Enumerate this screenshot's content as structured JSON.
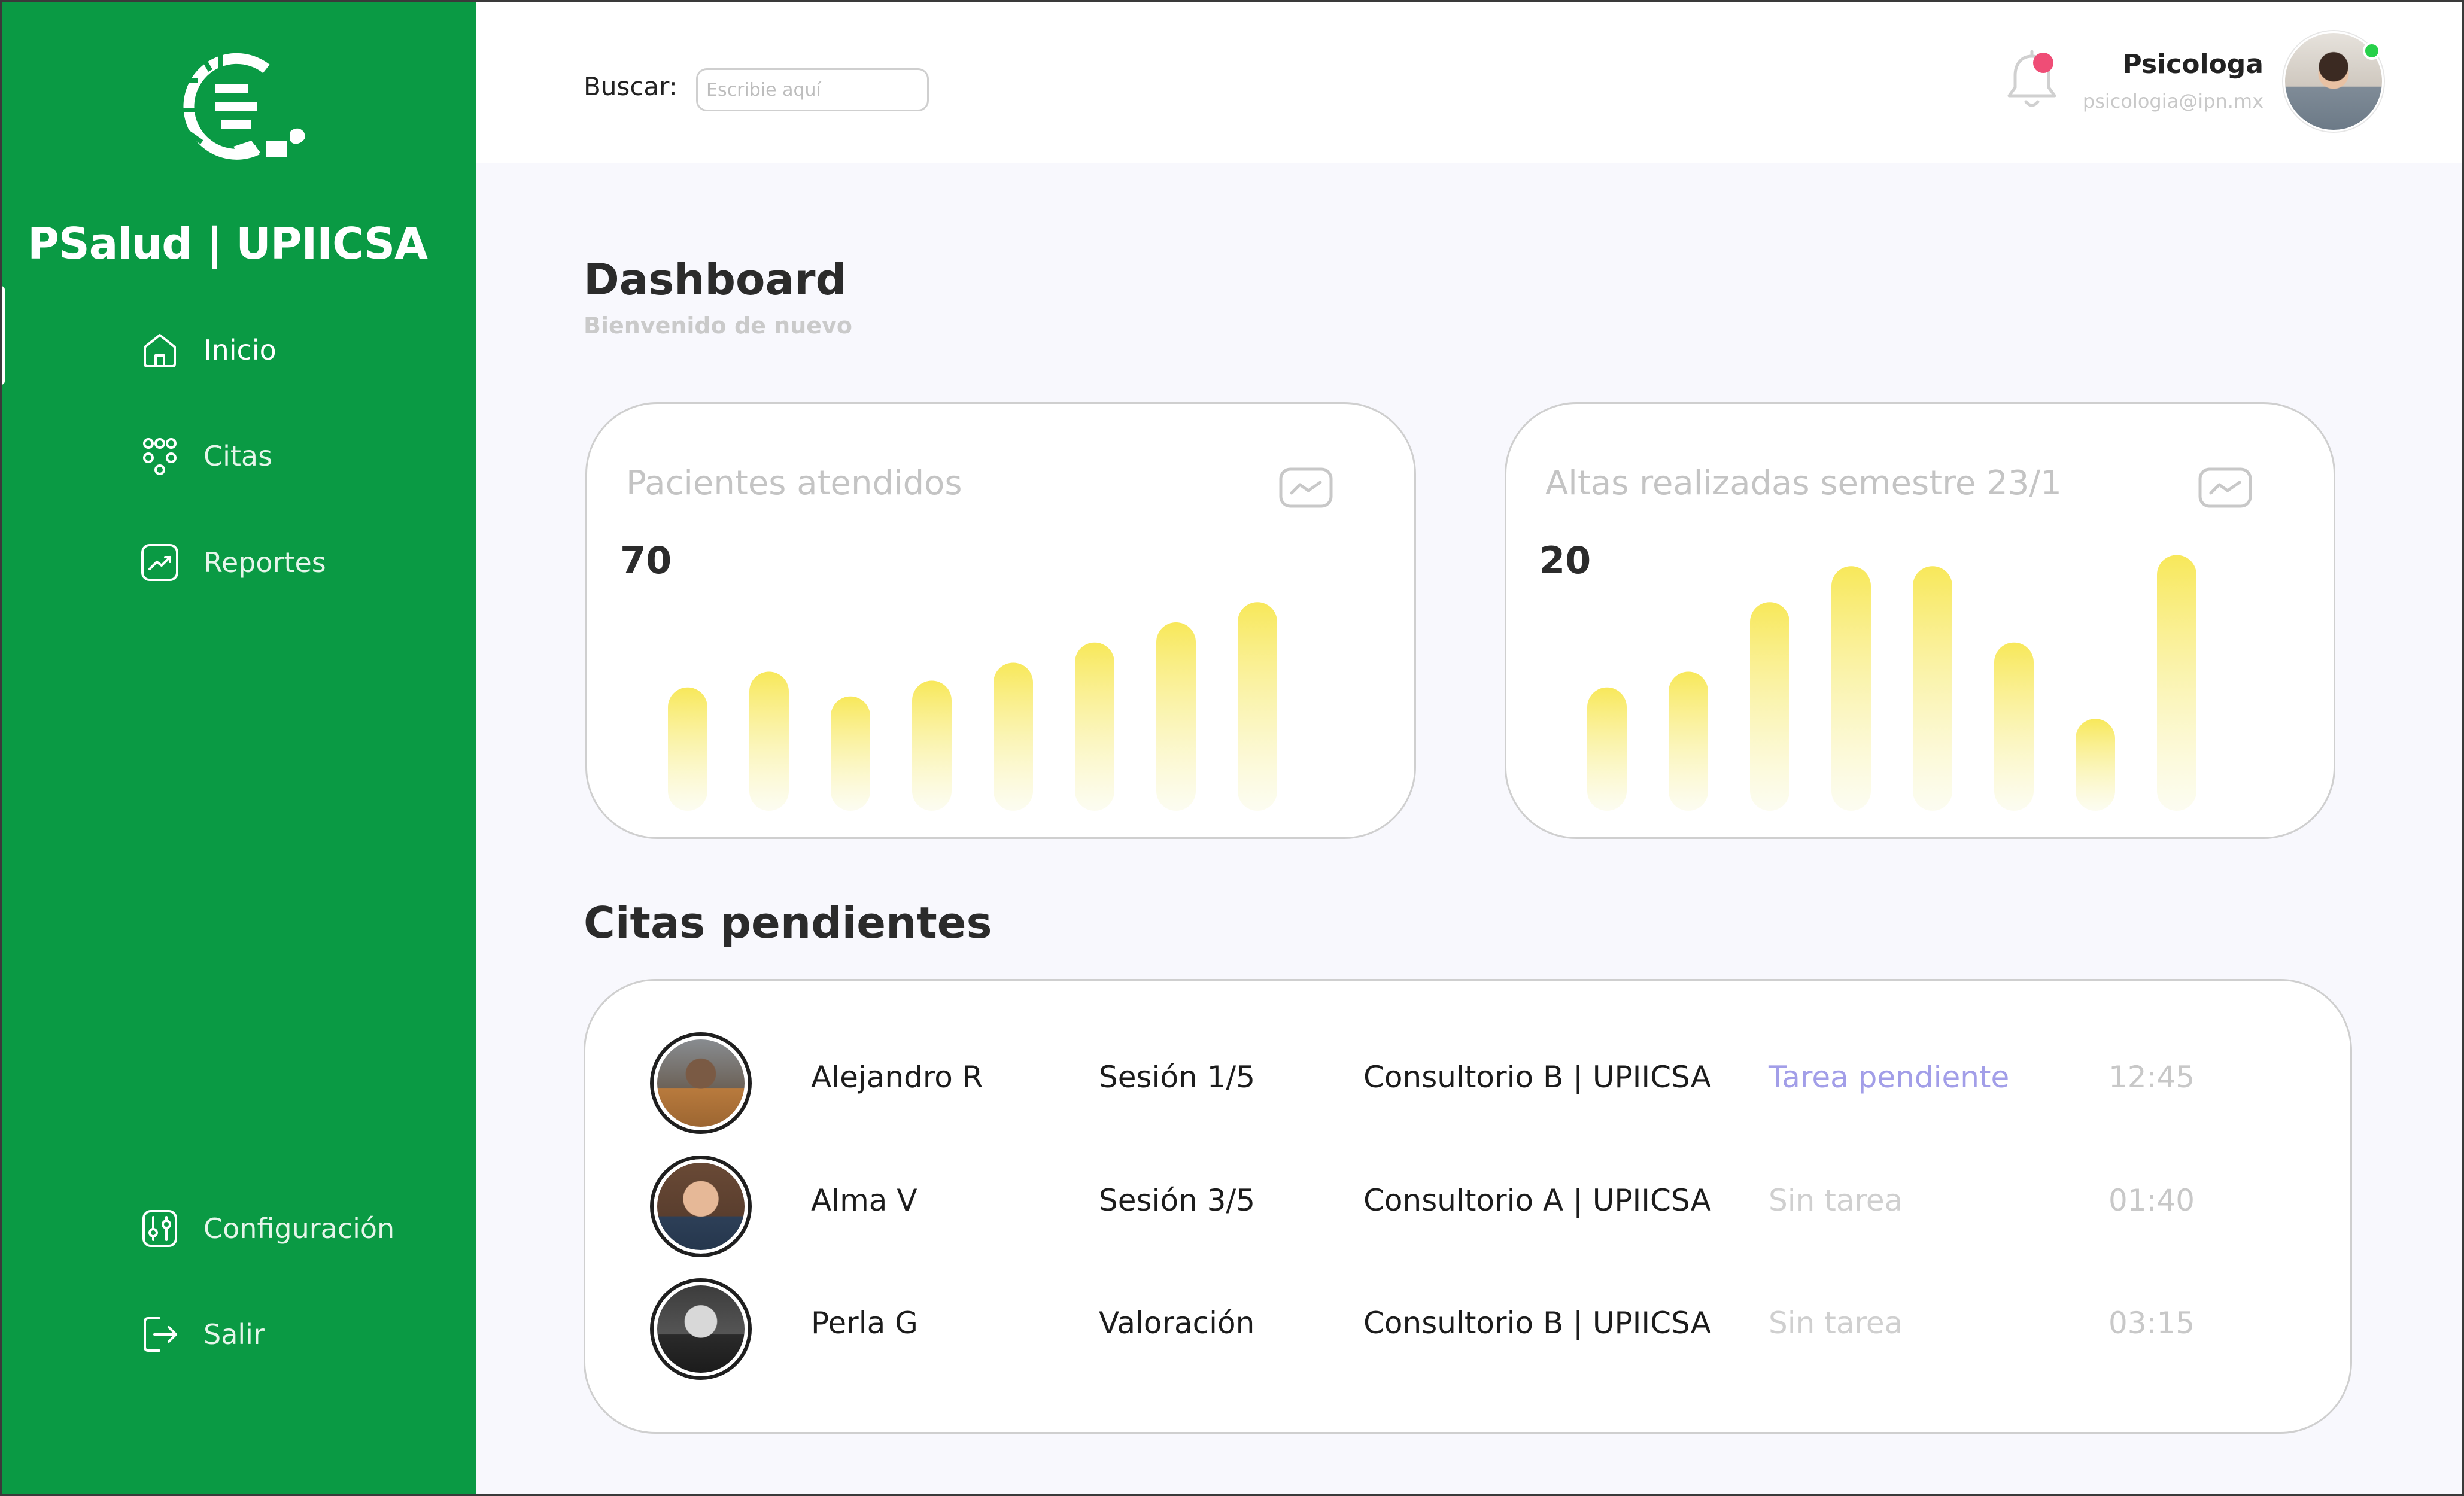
{
  "brand": {
    "title": "PSalud | UPIICSA"
  },
  "sidebar": {
    "items": [
      {
        "label": "Inicio",
        "icon": "home-icon"
      },
      {
        "label": "Citas",
        "icon": "people-icon"
      },
      {
        "label": "Reportes",
        "icon": "chart-trend-icon"
      }
    ],
    "bottom_items": [
      {
        "label": "Configuración",
        "icon": "settings-sliders-icon"
      },
      {
        "label": "Salir",
        "icon": "logout-icon"
      }
    ]
  },
  "header": {
    "search_label": "Buscar:",
    "search_placeholder": "Escribie aquí",
    "search_value": "",
    "user": {
      "name": "Psicologa",
      "email": "psicologia@ipn.mx"
    },
    "notification_dot": true,
    "online": true
  },
  "main": {
    "title": "Dashboard",
    "subtitle": "Bienvenido de nuevo"
  },
  "cards": [
    {
      "title": "Pacientes atendidos",
      "value": "70"
    },
    {
      "title": "Altas realizadas semestre 23/1",
      "value": "20"
    }
  ],
  "chart_data": [
    {
      "type": "bar",
      "title": "Pacientes atendidos",
      "values": [
        0.55,
        0.62,
        0.51,
        0.58,
        0.66,
        0.75,
        0.84,
        0.93
      ],
      "ylim": [
        0,
        1
      ],
      "grid": false
    },
    {
      "type": "bar",
      "title": "Altas realizadas semestre 23/1",
      "values": [
        0.55,
        0.62,
        0.93,
        1.09,
        1.09,
        0.75,
        0.41,
        1.14
      ],
      "ylim": [
        0,
        1.2
      ],
      "grid": false
    }
  ],
  "appointments": {
    "title": "Citas pendientes",
    "rows": [
      {
        "name": "Alejandro R",
        "session": "Sesión 1/5",
        "room": "Consultorio B | UPIICSA",
        "task": "Tarea pendiente",
        "task_status": "pending",
        "time": "12:45"
      },
      {
        "name": "Alma V",
        "session": "Sesión 3/5",
        "room": "Consultorio A | UPIICSA",
        "task": "Sin tarea",
        "task_status": "none",
        "time": "01:40"
      },
      {
        "name": "Perla G",
        "session": "Valoración",
        "room": "Consultorio B | UPIICSA",
        "task": "Sin tarea",
        "task_status": "none",
        "time": "03:15"
      }
    ]
  },
  "colors": {
    "sidebar": "#0a9a44",
    "bar_top": "#f8e85a",
    "pending_task": "#a29ee8",
    "notification": "#ef4d76",
    "online": "#27d04a"
  }
}
